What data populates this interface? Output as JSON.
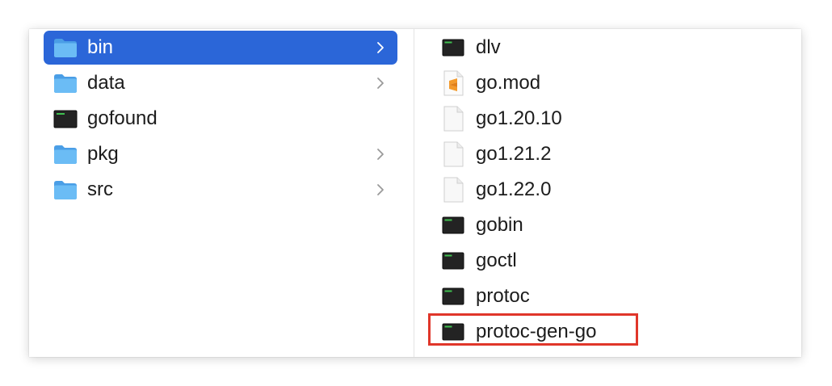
{
  "left_column": {
    "items": [
      {
        "label": "bin",
        "icon": "folder-icon",
        "has_chevron": true,
        "selected": true
      },
      {
        "label": "data",
        "icon": "folder-icon",
        "has_chevron": true,
        "selected": false
      },
      {
        "label": "gofound",
        "icon": "executable-icon",
        "has_chevron": false,
        "selected": false
      },
      {
        "label": "pkg",
        "icon": "folder-icon",
        "has_chevron": true,
        "selected": false
      },
      {
        "label": "src",
        "icon": "folder-icon",
        "has_chevron": true,
        "selected": false
      }
    ]
  },
  "right_column": {
    "items": [
      {
        "label": "dlv",
        "icon": "executable-icon"
      },
      {
        "label": "go.mod",
        "icon": "sublime-document-icon"
      },
      {
        "label": "go1.20.10",
        "icon": "blank-document-icon"
      },
      {
        "label": "go1.21.2",
        "icon": "blank-document-icon"
      },
      {
        "label": "go1.22.0",
        "icon": "blank-document-icon"
      },
      {
        "label": "gobin",
        "icon": "executable-icon"
      },
      {
        "label": "goctl",
        "icon": "executable-icon"
      },
      {
        "label": "protoc",
        "icon": "executable-icon"
      },
      {
        "label": "protoc-gen-go",
        "icon": "executable-icon",
        "highlighted": true
      }
    ]
  },
  "colors": {
    "selection": "#2b66d8",
    "highlight_border": "#e0362a",
    "folder": "#5aaef0",
    "executable_bg": "#232323",
    "text": "#1c1c1c"
  }
}
